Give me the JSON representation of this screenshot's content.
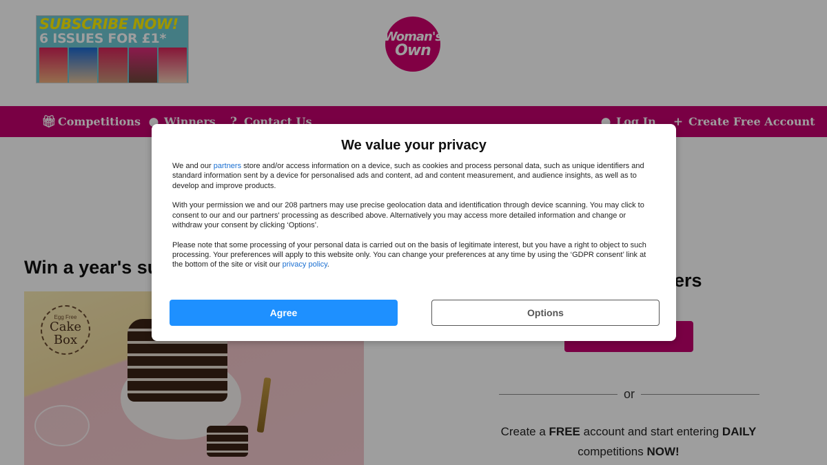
{
  "header": {
    "promo": {
      "line1": "SUBSCRIBE NOW!",
      "line2": "6 ISSUES FOR £1*"
    },
    "logo": {
      "line1": "Woman's",
      "line2": "Own"
    }
  },
  "nav": {
    "left": [
      {
        "label": "Competitions",
        "icon": "gift-icon"
      },
      {
        "label": "Winners",
        "icon": "map-pin-icon"
      },
      {
        "label": "Contact Us",
        "icon": "question-icon"
      }
    ],
    "right": [
      {
        "label": "Log In",
        "icon": "user-icon"
      },
      {
        "label": "Create Free Account",
        "icon": "user-plus-icon"
      }
    ]
  },
  "main": {
    "headline": "Win a year's su",
    "hero": {
      "brand_small": "Egg Free",
      "brand_line1": "Cake",
      "brand_line2": "Box"
    },
    "right_heading": "ers",
    "or_text": "or",
    "promo_copy": {
      "p1": "Create a ",
      "b1": "FREE",
      "p2": " account and start entering ",
      "b2": "DAILY",
      "p3": "competitions ",
      "b3": "NOW!"
    }
  },
  "consent": {
    "title": "We value your privacy",
    "para1_pre": "We and our ",
    "para1_link": "partners",
    "para1_post": " store and/or access information on a device, such as cookies and process personal data, such as unique identifiers and standard information sent by a device for personalised ads and content, ad and content measurement, and audience insights, as well as to develop and improve products.",
    "para2": "With your permission we and our 208 partners may use precise geolocation data and identification through device scanning. You may click to consent to our and our partners' processing as described above. Alternatively you may access more detailed information and change or withdraw your consent by clicking ‘Options’.",
    "para3_pre": "Please note that some processing of your personal data is carried out on the basis of legitimate interest, but you have a right to object to such processing. Your preferences will apply to this website only. You can change your preferences at any time by using the ‘GDPR consent’ link at the bottom of the site or visit our ",
    "para3_link": "privacy policy",
    "para3_post": ".",
    "agree_label": "Agree",
    "options_label": "Options"
  },
  "colors": {
    "brand": "#c4006f",
    "agree": "#1e90ff",
    "link": "#1a6fd1"
  }
}
